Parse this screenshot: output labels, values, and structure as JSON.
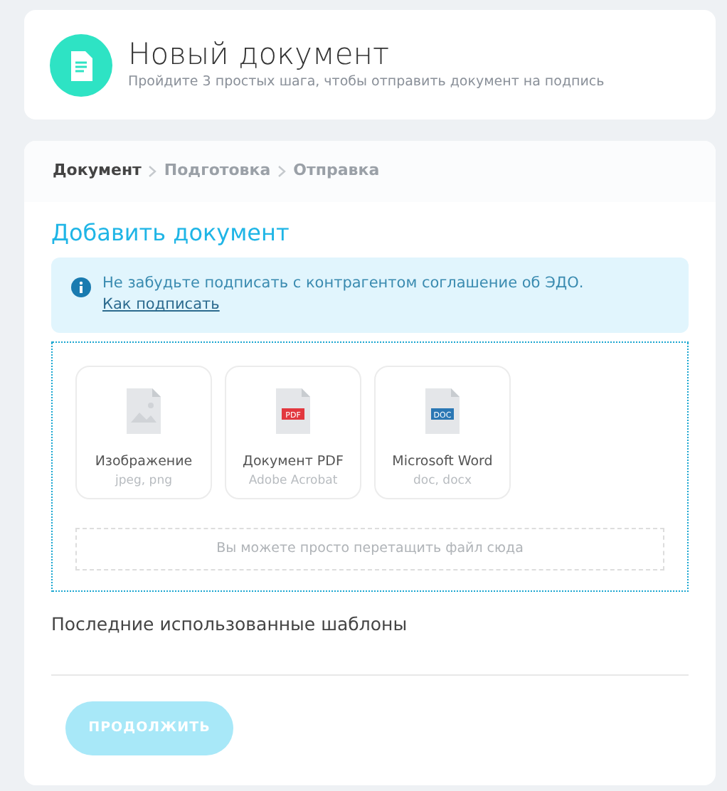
{
  "header": {
    "title": "Новый документ",
    "subtitle": "Пройдите 3 простых шага, чтобы отправить документ на подпись"
  },
  "steps": [
    {
      "label": "Документ",
      "selected": true
    },
    {
      "label": "Подготовка",
      "selected": false
    },
    {
      "label": "Отправка",
      "selected": false
    }
  ],
  "section_title": "Добавить документ",
  "alert": {
    "text": "Не забудьте подписать с контрагентом соглашение об ЭДО.",
    "link": "Как подписать"
  },
  "file_types": [
    {
      "kind": "image",
      "title": "Изображение",
      "formats": "jpeg, png"
    },
    {
      "kind": "pdf",
      "badge": "PDF",
      "title": "Документ PDF",
      "formats": "Adobe Acrobat"
    },
    {
      "kind": "doc",
      "badge": "DOC",
      "title": "Microsoft Word",
      "formats": "doc, docx"
    }
  ],
  "drop_hint": "Вы можете просто перетащить файл сюда",
  "templates_title": "Последние использованные шаблоны",
  "continue_button": {
    "label": "ПРОДОЛЖИТЬ",
    "disabled": true
  }
}
